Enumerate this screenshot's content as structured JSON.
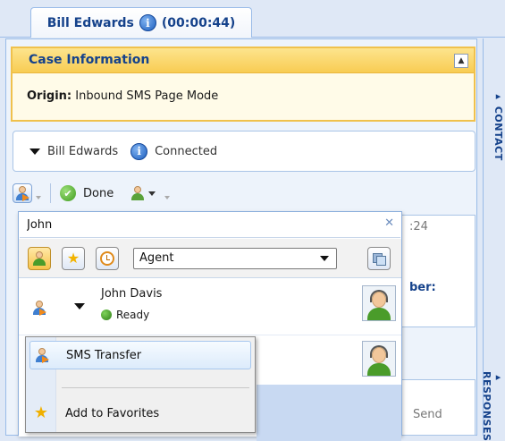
{
  "tab": {
    "label": "Bill Edwards",
    "timer": "(00:00:44)"
  },
  "case": {
    "title": "Case Information",
    "origin_label": "Origin:",
    "origin_value": "Inbound SMS Page Mode"
  },
  "party": {
    "name": "Bill Edwards",
    "status": "Connected"
  },
  "toolbar": {
    "done_label": "Done"
  },
  "search": {
    "value": "John"
  },
  "filter": {
    "selected_type": "Agent"
  },
  "agents": [
    {
      "name": "John Davis",
      "status": "Ready",
      "status_color": "#3d9a1c"
    }
  ],
  "menu": {
    "items": [
      "SMS Transfer",
      "Add to Favorites"
    ]
  },
  "background": {
    "time_fragment": ":24",
    "member_fragment": "ber:",
    "send_label": "Send"
  },
  "side_tabs": {
    "contact": "CONTACT",
    "responses": "RESPONSES"
  },
  "colors": {
    "accent": "#15428b",
    "panel_border": "#99bbe8",
    "case_header": "#f8cc53"
  },
  "icons": [
    "info-icon",
    "transfer-agent-icon",
    "check-icon",
    "conference-icon",
    "close-icon",
    "star-icon",
    "clock-icon",
    "directory-icon",
    "avatar-icon"
  ]
}
